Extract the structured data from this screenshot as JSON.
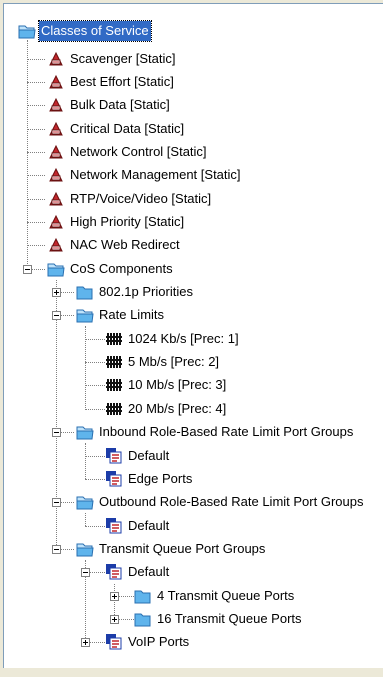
{
  "tree": {
    "root_label": "Classes of Service",
    "classes": [
      "Scavenger [Static]",
      "Best Effort [Static]",
      "Bulk Data [Static]",
      "Critical Data [Static]",
      "Network Control [Static]",
      "Network Management [Static]",
      "RTP/Voice/Video [Static]",
      "High Priority [Static]",
      "NAC Web Redirect"
    ],
    "components": {
      "label": "CoS Components",
      "priorities_label": "802.1p Priorities",
      "rate_limits": {
        "label": "Rate Limits",
        "items": [
          "1024 Kb/s [Prec: 1]",
          "5 Mb/s [Prec: 2]",
          "10 Mb/s [Prec: 3]",
          "20 Mb/s [Prec: 4]"
        ]
      },
      "inbound": {
        "label": "Inbound Role-Based Rate Limit Port Groups",
        "items": [
          "Default",
          "Edge Ports"
        ]
      },
      "outbound": {
        "label": "Outbound Role-Based Rate Limit Port Groups",
        "items": [
          "Default"
        ]
      },
      "txq": {
        "label": "Transmit Queue Port Groups",
        "default_label": "Default",
        "default_children": [
          "4 Transmit Queue Ports",
          "16 Transmit Queue Ports"
        ],
        "voip_label": "VoIP Ports"
      }
    }
  },
  "colors": {
    "selection": "#316ac5",
    "folder": "#5fb4ec",
    "cos_icon_red": "#c0262c",
    "port_group_blue": "#1c3ca8"
  }
}
